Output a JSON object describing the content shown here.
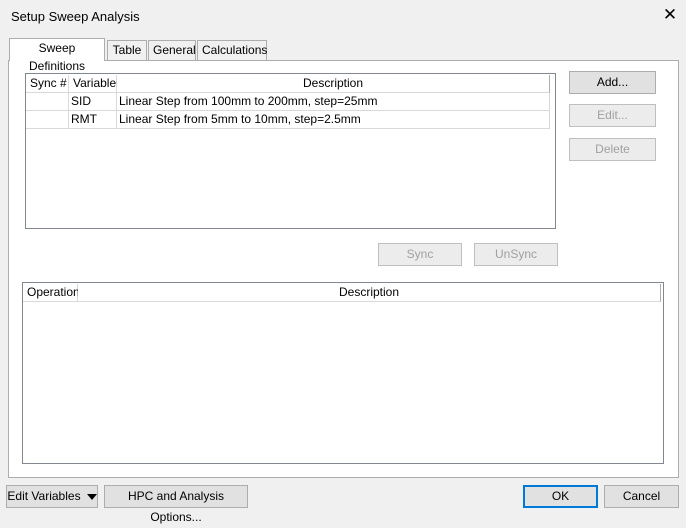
{
  "window": {
    "title": "Setup Sweep Analysis"
  },
  "tabs": [
    {
      "label": "Sweep Definitions"
    },
    {
      "label": "Table"
    },
    {
      "label": "General"
    },
    {
      "label": "Calculations"
    }
  ],
  "sweep_table": {
    "columns": [
      "Sync #",
      "Variable",
      "Description"
    ],
    "rows": [
      {
        "sync": "",
        "variable": "SID",
        "description": "Linear Step from 100mm to 200mm, step=25mm"
      },
      {
        "sync": "",
        "variable": "RMT",
        "description": "Linear Step from 5mm to 10mm, step=2.5mm"
      }
    ]
  },
  "side_buttons": {
    "add": "Add...",
    "edit": "Edit...",
    "delete": "Delete"
  },
  "sync_buttons": {
    "sync": "Sync",
    "unsync": "UnSync"
  },
  "operation_table": {
    "columns": [
      "Operation",
      "Description"
    ]
  },
  "footer": {
    "edit_variables": "Edit Variables",
    "hpc_options": "HPC and Analysis Options...",
    "ok": "OK",
    "cancel": "Cancel"
  }
}
